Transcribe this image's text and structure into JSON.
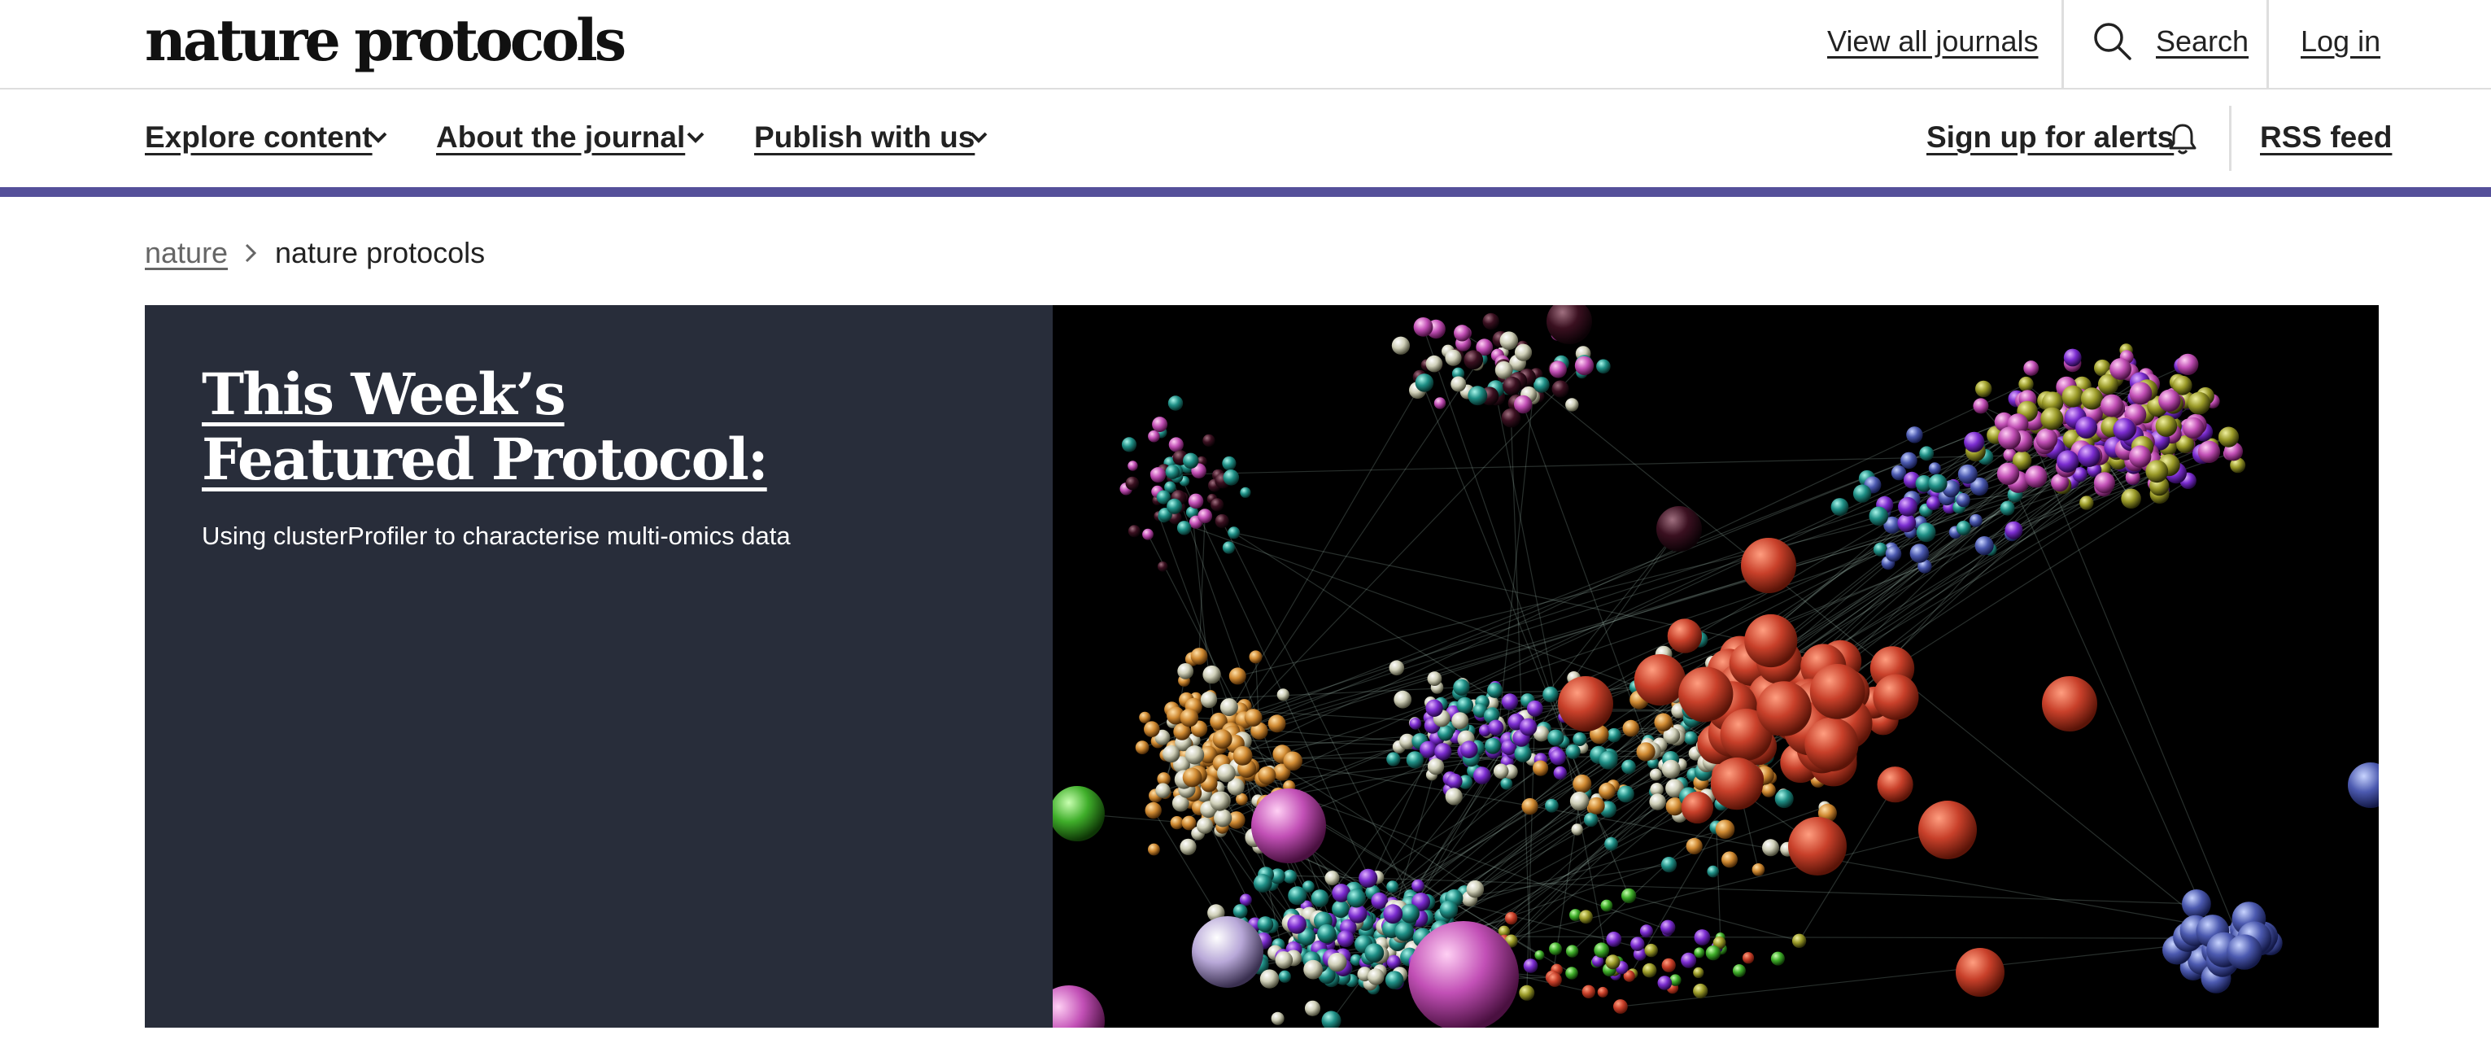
{
  "header": {
    "logo": "nature protocols",
    "view_all_journals": "View all journals",
    "search": "Search",
    "login": "Log in"
  },
  "nav": {
    "explore": "Explore content",
    "about": "About the journal",
    "publish": "Publish with us",
    "alerts": "Sign up for alerts",
    "rss": "RSS feed"
  },
  "breadcrumb": {
    "root": "nature",
    "current": "nature protocols"
  },
  "hero": {
    "title": "This Week’s Featured Protocol:",
    "subtitle": "Using clusterProfiler to characterise multi-omics data"
  },
  "colors": {
    "accent": "#55509a",
    "hero_panel": "#282d3a"
  }
}
